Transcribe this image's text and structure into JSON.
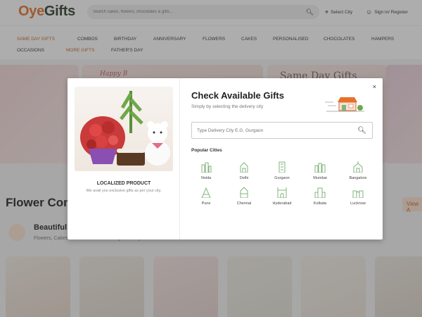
{
  "header": {
    "logo_oye": "Oye",
    "logo_gifts": "Gifts",
    "search_placeholder": "Search cakes, flowers, chocolates & gifts...",
    "select_city": "Select City",
    "signin": "Sign in/ Register"
  },
  "nav": {
    "row1": [
      "SAME DAY GIFTS",
      "COMBOS",
      "BIRTHDAY",
      "ANNIVERSARY",
      "FLOWERS",
      "CAKES",
      "PERSONALISED",
      "CHOCOLATES",
      "HAMPERS"
    ],
    "row2": [
      "OCCASIONS",
      "MORE GIFTS",
      "FATHER'S DAY"
    ]
  },
  "background": {
    "section_title": "Flower Com",
    "section_sub": "Beautiful",
    "section_desc": "Flowers, Cakes, Chocolates & More ~ gift for any",
    "view_all": "View A",
    "banner_text": "Same Day Gifts",
    "banner_text2": "Happy B"
  },
  "modal": {
    "title": "Check Available Gifts",
    "subtitle": "Simply by selecting the delivery city",
    "input_placeholder": "Type Delivery City E.G. Gurgaon",
    "popular_label": "Popular Cities",
    "left_title": "LOCALIZED PRODUCT",
    "left_desc": "We avail you exclusive gifts as per your city.",
    "close_label": "×",
    "cities": [
      "Noida",
      "Delhi",
      "Gurgaon",
      "Mumbai",
      "Bangalore",
      "Pune",
      "Chennai",
      "Hyderabad",
      "Kolkata",
      "Lucknow"
    ]
  },
  "icons": {
    "search": "search-icon",
    "location": "location-pin-icon",
    "user": "user-icon",
    "city": "city-landmark-icon",
    "close": "close-icon"
  },
  "colors": {
    "brand_orange": "#e8702a",
    "brand_dark": "#2d3b2d",
    "city_icon_green": "#7fb57a"
  }
}
